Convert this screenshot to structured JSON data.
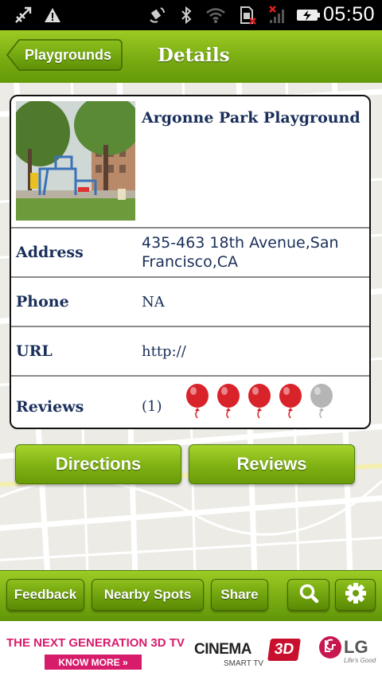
{
  "status_bar": {
    "time": "05:50",
    "icons": [
      "usb-debug-icon",
      "warning-icon",
      "gps-icon",
      "bluetooth-icon",
      "wifi-icon",
      "sim-card-error-icon",
      "signal-no-service-icon",
      "battery-charging-icon"
    ]
  },
  "header": {
    "back_label": "Playgrounds",
    "title": "Details"
  },
  "details": {
    "name": "Argonne Park Playground",
    "rows": [
      {
        "label": "Address",
        "value": "435-463 18th Avenue,San Francisco,CA"
      },
      {
        "label": "Phone",
        "value": "NA"
      },
      {
        "label": "URL",
        "value": "http://"
      },
      {
        "label": "Reviews",
        "value": "(1)"
      }
    ],
    "rating": {
      "filled": 4,
      "max": 5,
      "filled_color": "#d9232a",
      "empty_color": "#b5b5b5"
    }
  },
  "actions": {
    "directions_label": "Directions",
    "reviews_label": "Reviews"
  },
  "toolbar": {
    "feedback_label": "Feedback",
    "nearby_label": "Nearby Spots",
    "share_label": "Share",
    "search_icon": "search-icon",
    "settings_icon": "gear-icon"
  },
  "ad": {
    "headline": "THE NEXT GENERATION 3D TV",
    "cta": "KNOW MORE »",
    "brand_cinema": "CINEMA",
    "brand_3d": "3D",
    "brand_smarttv": "SMART TV",
    "brand_lg": "LG",
    "brand_tagline": "Life's Good"
  },
  "colors": {
    "accent_green": "#7aae12",
    "text_navy": "#1a2f5a",
    "ad_pink": "#d81c6c"
  }
}
